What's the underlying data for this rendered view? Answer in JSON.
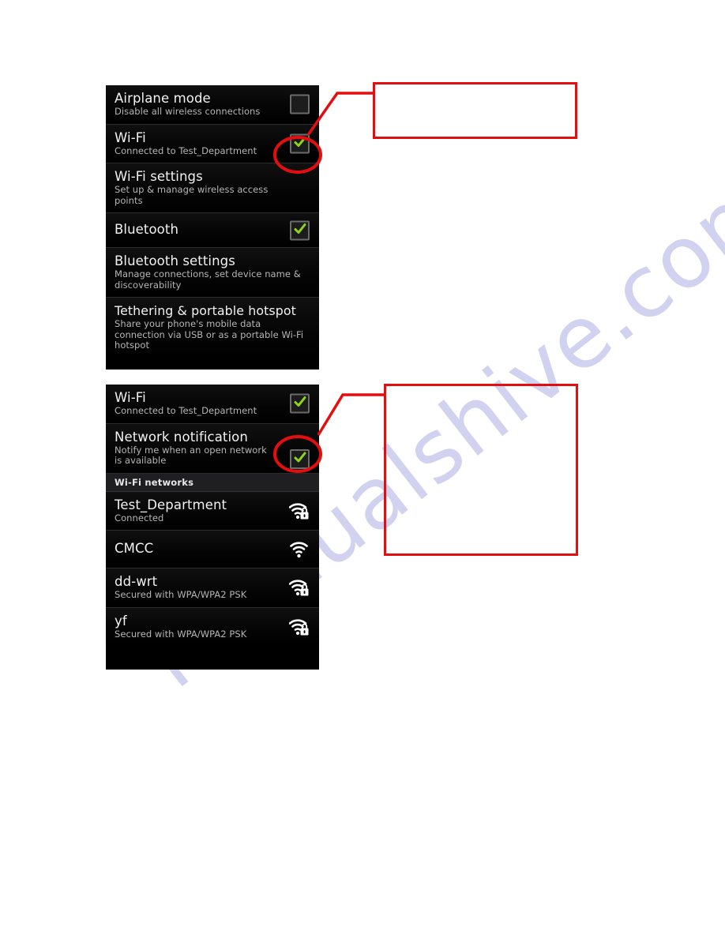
{
  "document": {
    "watermark": "manualshive.com",
    "accent_red": "#e50e0e",
    "checkbox_green": "#8fd41d",
    "panel_background": "#000000"
  },
  "settings_panel": {
    "name": "wireless-and-networks-settings",
    "rows": [
      {
        "title": "Airplane mode",
        "subtitle": "Disable all wireless connections",
        "control": "checkbox",
        "checked": false
      },
      {
        "title": "Wi-Fi",
        "subtitle": "Connected to Test_Department",
        "control": "checkbox",
        "checked": true
      },
      {
        "title": "Wi-Fi settings",
        "subtitle": "Set up & manage wireless access points",
        "control": "none",
        "checked": false
      },
      {
        "title": "Bluetooth",
        "subtitle": "",
        "control": "checkbox",
        "checked": true
      },
      {
        "title": "Bluetooth settings",
        "subtitle": "Manage connections, set device name & discoverability",
        "control": "none",
        "checked": false
      },
      {
        "title": "Tethering & portable hotspot",
        "subtitle": "Share your phone's mobile data connection via USB or as a portable Wi-Fi hotspot",
        "control": "none",
        "checked": false
      }
    ]
  },
  "wifi_panel": {
    "name": "wifi-settings",
    "rows": [
      {
        "title": "Wi-Fi",
        "subtitle": "Connected to Test_Department",
        "control": "checkbox",
        "checked": true
      },
      {
        "title": "Network notification",
        "subtitle": "Notify me when an open network is available",
        "control": "checkbox",
        "checked": true
      }
    ],
    "section_header": "Wi-Fi networks",
    "networks": [
      {
        "ssid": "Test_Department",
        "status": "Connected",
        "icon": "wifi-secured-icon",
        "secured": true,
        "bars": 3
      },
      {
        "ssid": "CMCC",
        "status": "",
        "icon": "wifi-open-icon",
        "secured": false,
        "bars": 3
      },
      {
        "ssid": "dd-wrt",
        "status": "Secured with WPA/WPA2 PSK",
        "icon": "wifi-secured-icon",
        "secured": true,
        "bars": 3
      },
      {
        "ssid": "yf",
        "status": "Secured with WPA/WPA2 PSK",
        "icon": "wifi-secured-icon",
        "secured": true,
        "bars": 3
      }
    ]
  },
  "annotations": {
    "callout_1": {
      "name": "callout-box-top",
      "text": ""
    },
    "callout_2": {
      "name": "callout-box-bottom",
      "text": ""
    },
    "highlight_1": {
      "name": "wifi-toggle-highlight"
    },
    "highlight_2": {
      "name": "network-notification-toggle-highlight"
    }
  }
}
